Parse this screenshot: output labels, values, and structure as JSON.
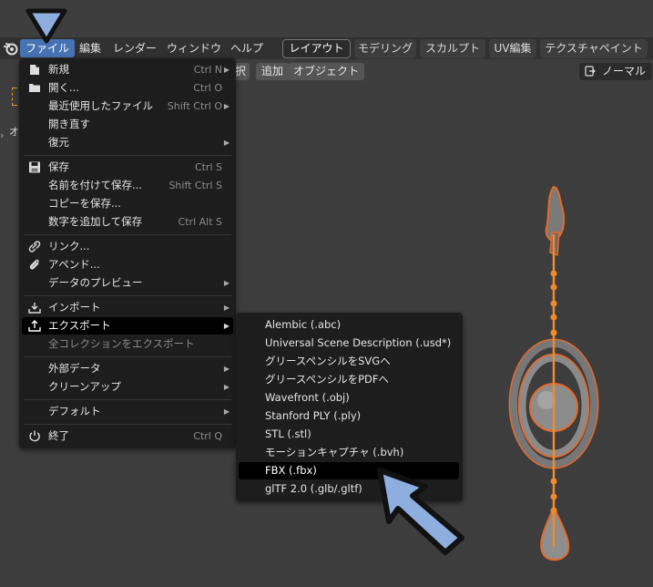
{
  "topbar": {
    "menus": [
      "ファイル",
      "編集",
      "レンダー",
      "ウィンドウ",
      "ヘルプ"
    ],
    "workspaces": [
      "レイアウト",
      "モデリング",
      "スカルプト",
      "UV編集",
      "テクスチャペイント"
    ]
  },
  "viewport": {
    "header_buttons": [
      "択",
      "追加",
      "オブジェクト"
    ],
    "shading_mode": "ノーマル",
    "side_label": "オ"
  },
  "file_menu": {
    "items": [
      {
        "label": "新規",
        "shortcut": "Ctrl N",
        "icon": "new-file-icon",
        "submenu": true
      },
      {
        "label": "開く...",
        "shortcut": "Ctrl O",
        "icon": "folder-icon"
      },
      {
        "label": "最近使用したファイル",
        "shortcut": "Shift Ctrl O",
        "submenu": true
      },
      {
        "label": "開き直す"
      },
      {
        "label": "復元",
        "submenu": true
      },
      {
        "label": "保存",
        "shortcut": "Ctrl S",
        "icon": "save-icon"
      },
      {
        "label": "名前を付けて保存...",
        "shortcut": "Shift Ctrl S"
      },
      {
        "label": "コピーを保存..."
      },
      {
        "label": "数字を追加して保存",
        "shortcut": "Ctrl Alt S"
      },
      {
        "label": "リンク...",
        "icon": "link-icon"
      },
      {
        "label": "アペンド...",
        "icon": "append-icon"
      },
      {
        "label": "データのプレビュー",
        "submenu": true
      },
      {
        "label": "インポート",
        "icon": "import-icon",
        "submenu": true
      },
      {
        "label": "エクスポート",
        "icon": "export-icon",
        "submenu": true,
        "selected": true
      },
      {
        "label": "全コレクションをエクスポート",
        "disabled": true
      },
      {
        "label": "外部データ",
        "submenu": true
      },
      {
        "label": "クリーンアップ",
        "submenu": true
      },
      {
        "label": "デフォルト",
        "submenu": true
      },
      {
        "label": "終了",
        "shortcut": "Ctrl Q",
        "icon": "power-icon"
      }
    ]
  },
  "export_submenu": {
    "items": [
      {
        "label": "Alembic (.abc)"
      },
      {
        "label": "Universal Scene Description (.usd*)"
      },
      {
        "label": "グリースペンシルをSVGへ"
      },
      {
        "label": "グリースペンシルをPDFへ"
      },
      {
        "label": "Wavefront (.obj)"
      },
      {
        "label": "Stanford PLY (.ply)"
      },
      {
        "label": "STL (.stl)"
      },
      {
        "label": "モーションキャプチャ (.bvh)"
      },
      {
        "label": "FBX (.fbx)",
        "selected": true
      },
      {
        "label": "glTF 2.0 (.glb/.gltf)"
      }
    ]
  },
  "colors": {
    "accent": "#4772b3",
    "menu_bg": "#1d1d1d",
    "selection_outline": "#e8692a",
    "annotation_arrow": "#8eaee0"
  }
}
